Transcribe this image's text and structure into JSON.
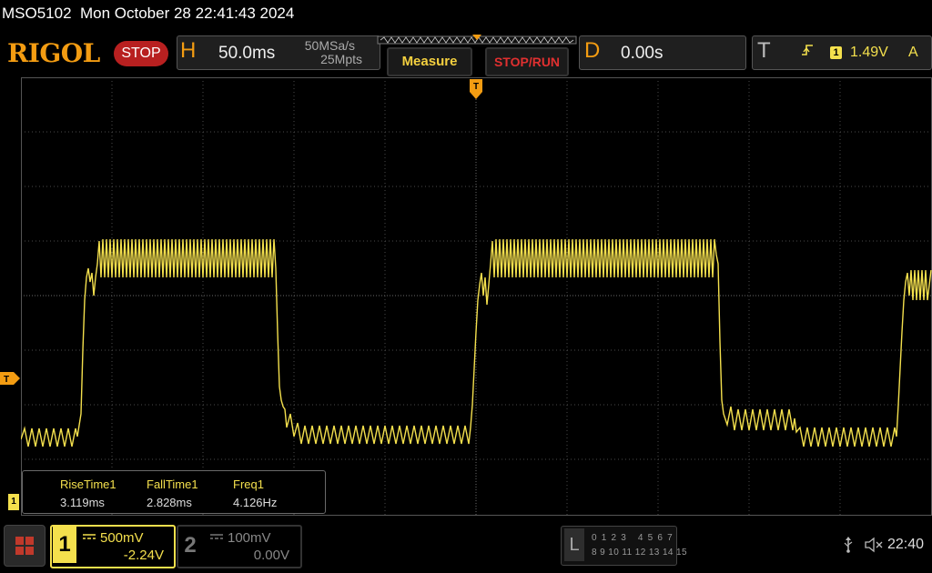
{
  "title_bar": {
    "text": "MSO5102  Mon October 28 22:41:43 2024"
  },
  "brand": {
    "logo": "RIGOL",
    "run_state": "STOP"
  },
  "horizontal": {
    "letter": "H",
    "timebase": "50.0ms",
    "sample_rate": "50MSa/s",
    "memory_depth": "25Mpts"
  },
  "buttons": {
    "measure": "Measure",
    "stop_run": "STOP/RUN"
  },
  "delay": {
    "letter": "D",
    "value": "0.00s"
  },
  "trigger": {
    "letter": "T",
    "slope_icon": "rising-edge-icon",
    "source": "1",
    "level": "1.49V",
    "mode": "A",
    "marker": "T"
  },
  "measurements": [
    {
      "label": "RiseTime1",
      "value": "3.119ms"
    },
    {
      "label": "FallTime1",
      "value": "2.828ms"
    },
    {
      "label": "Freq1",
      "value": "4.126Hz"
    }
  ],
  "channels": [
    {
      "number": "1",
      "scale": "500mV",
      "offset": "-2.24V",
      "active": true,
      "color": "#f4e04d",
      "marker": "1"
    },
    {
      "number": "2",
      "scale": "100mV",
      "offset": "0.00V",
      "active": false,
      "color": "#888888"
    }
  ],
  "logic_analyzer": {
    "letter": "L",
    "row1": "0 1 2 3   4 5 6 7",
    "row2": "8 9 10 11 12 13 14 15"
  },
  "status": {
    "usb_icon": "usb-icon",
    "speaker_icon": "speaker-muted-icon",
    "time": "22:40"
  },
  "colors": {
    "brand_orange": "#f39c12",
    "trace_yellow": "#f4e04d",
    "stop_red": "#b82020"
  }
}
